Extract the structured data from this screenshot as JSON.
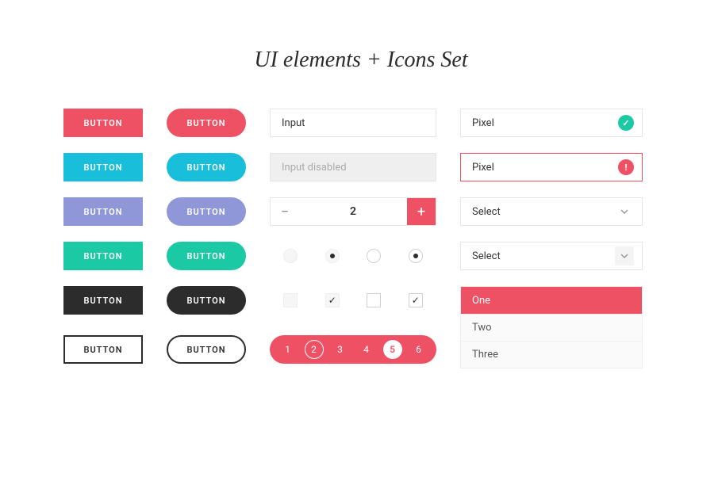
{
  "title": "UI elements + Icons Set",
  "buttons": {
    "label": "BUTTON"
  },
  "inputs": {
    "placeholder": "Input",
    "disabled": "Input disabled"
  },
  "stepper": {
    "value": "2"
  },
  "pagination": [
    "1",
    "2",
    "3",
    "4",
    "5",
    "6"
  ],
  "selects": {
    "valid": "Pixel",
    "error": "Pixel",
    "s1": "Select",
    "s2": "Select"
  },
  "dropdown": {
    "one": "One",
    "two": "Two",
    "three": "Three"
  }
}
